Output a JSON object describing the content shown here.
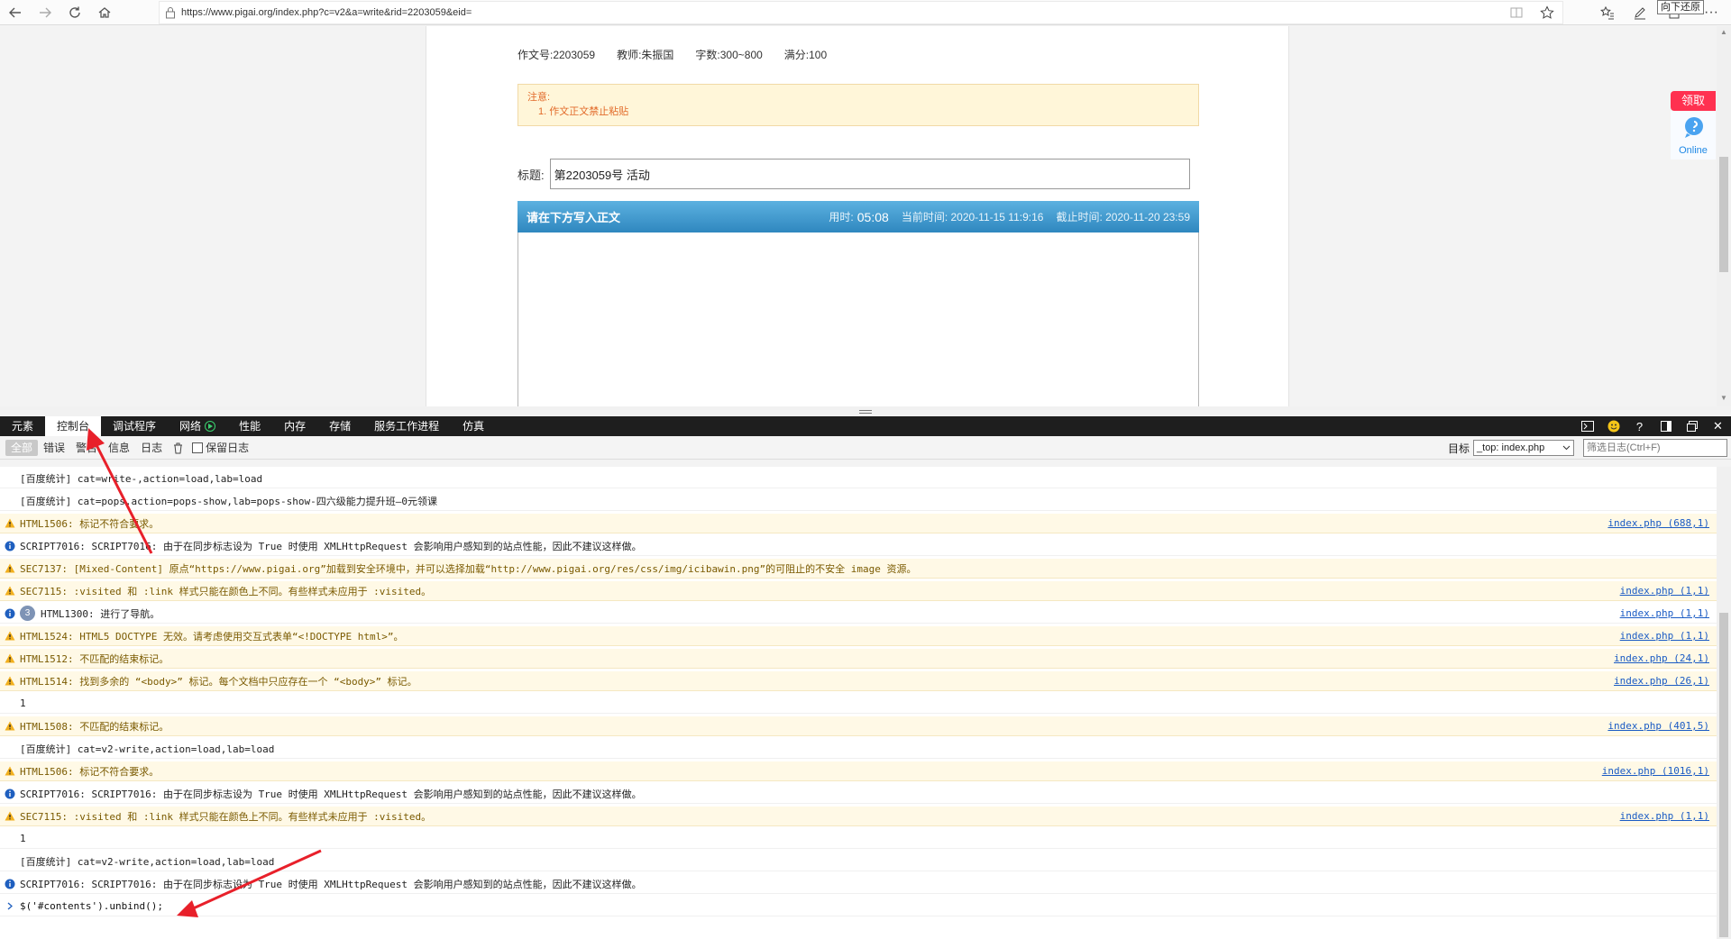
{
  "browser": {
    "url": "https://www.pigai.org/index.php?c=v2&a=write&rid=2203059&eid=",
    "tooltip": "向下还原"
  },
  "page": {
    "meta": [
      "作文号:2203059",
      "教师:朱振国",
      "字数:300~800",
      "满分:100"
    ],
    "notice_title": "注意:",
    "notice_item": "1. 作文正文禁止粘贴",
    "title_label": "标题:",
    "title_value": "第2203059号 活动",
    "editor": {
      "heading": "请在下方写入正文",
      "time_label": "用时:",
      "time_value": "05:08",
      "current_time": "当前时间: 2020-11-15 11:9:16",
      "deadline": "截止时间: 2020-11-20 23:59"
    },
    "widget": {
      "claim": "领取",
      "online": "Online"
    }
  },
  "devtools": {
    "tabs": [
      "元素",
      "控制台",
      "调试程序",
      "网络",
      "性能",
      "内存",
      "存储",
      "服务工作进程",
      "仿真"
    ],
    "active_tab": "控制台",
    "filters": [
      "全部",
      "错误",
      "警告",
      "信息",
      "日志"
    ],
    "preserve_log": "保留日志",
    "target_label": "目标",
    "target_value": "_top: index.php",
    "filter_placeholder": "筛选日志(Ctrl+F)"
  },
  "console": {
    "rows": [
      {
        "type": "log",
        "text": "[百度统计] cat=write-,action=load,lab=load",
        "src": ""
      },
      {
        "type": "log",
        "text": "[百度统计] cat=pops,action=pops-show,lab=pops-show-四六级能力提升班—0元领课",
        "src": ""
      },
      {
        "type": "warn",
        "text": "HTML1506: 标记不符合要求。",
        "src": "index.php (688,1)"
      },
      {
        "type": "info",
        "text": "SCRIPT7016: SCRIPT7016: 由于在同步标志设为 True 时使用 XMLHttpRequest 会影响用户感知到的站点性能，因此不建议这样做。",
        "src": ""
      },
      {
        "type": "warn",
        "text": "SEC7137: [Mixed-Content] 原点“https://www.pigai.org”加载到安全环境中，并可以选择加载“http://www.pigai.org/res/css/img/icibawin.png”的可阻止的不安全 image 资源。",
        "src": ""
      },
      {
        "type": "warn",
        "text": "SEC7115: :visited 和 :link 样式只能在颜色上不同。有些样式未应用于 :visited。",
        "src": "index.php (1,1)"
      },
      {
        "type": "info",
        "badge": "3",
        "text": "HTML1300: 进行了导航。",
        "src": "index.php (1,1)"
      },
      {
        "type": "warn",
        "text": "HTML1524: HTML5 DOCTYPE 无效。请考虑使用交互式表单“<!DOCTYPE html>”。",
        "src": "index.php (1,1)"
      },
      {
        "type": "warn",
        "text": "HTML1512: 不匹配的结束标记。",
        "src": "index.php (24,1)"
      },
      {
        "type": "warn",
        "text": "HTML1514: 找到多余的 “<body>” 标记。每个文档中只应存在一个 “<body>” 标记。",
        "src": "index.php (26,1)"
      },
      {
        "type": "log",
        "text": "1",
        "src": ""
      },
      {
        "type": "warn",
        "text": "HTML1508: 不匹配的结束标记。",
        "src": "index.php (401,5)"
      },
      {
        "type": "log",
        "text": "[百度统计] cat=v2-write,action=load,lab=load",
        "src": ""
      },
      {
        "type": "warn",
        "text": "HTML1506: 标记不符合要求。",
        "src": "index.php (1016,1)"
      },
      {
        "type": "info",
        "text": "SCRIPT7016: SCRIPT7016: 由于在同步标志设为 True 时使用 XMLHttpRequest 会影响用户感知到的站点性能，因此不建议这样做。",
        "src": ""
      },
      {
        "type": "warn",
        "text": "SEC7115: :visited 和 :link 样式只能在颜色上不同。有些样式未应用于 :visited。",
        "src": "index.php (1,1)"
      },
      {
        "type": "log",
        "text": "1",
        "src": ""
      },
      {
        "type": "log",
        "text": "[百度统计] cat=v2-write,action=load,lab=load",
        "src": ""
      },
      {
        "type": "info",
        "text": "SCRIPT7016: SCRIPT7016: 由于在同步标志设为 True 时使用 XMLHttpRequest 会影响用户感知到的站点性能，因此不建议这样做。",
        "src": ""
      },
      {
        "type": "input",
        "text": "$('#contents').unbind();",
        "src": ""
      }
    ]
  },
  "colors": {
    "annotation_red": "#e8202a",
    "editor_blue": "#3a93c8",
    "notice_orange": "#e26b2a"
  }
}
